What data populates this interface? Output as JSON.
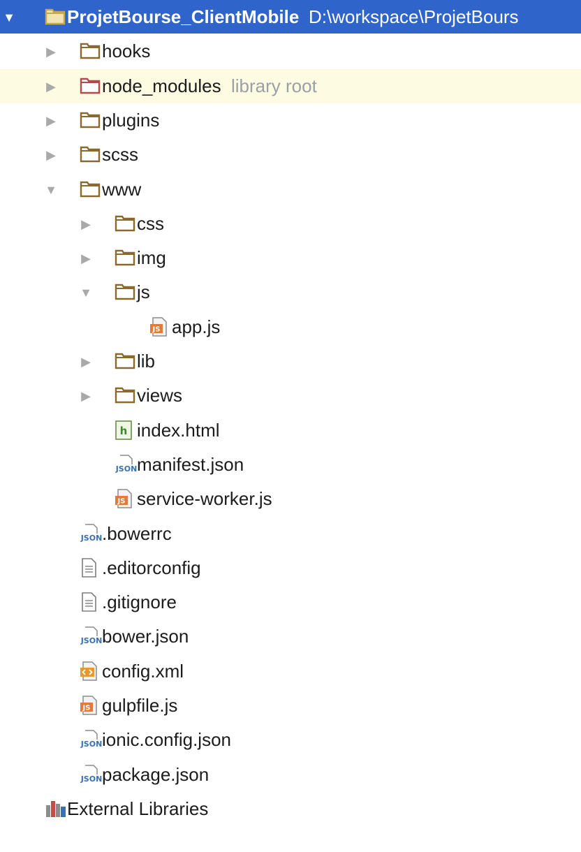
{
  "colors": {
    "selection": "#2f65ca",
    "highlight_row": "#fdfbe1",
    "folder": "#8a6a2c",
    "library_folder": "#b24a4a",
    "arrow": "#a9a9a9",
    "hint_text": "#9aa0a6"
  },
  "tree": [
    {
      "depth": 0,
      "arrow": "expanded",
      "icon": "folder-icon",
      "label": "ProjetBourse_ClientMobile",
      "hint": "D:\\workspace\\ProjetBours",
      "state": "selected"
    },
    {
      "depth": 1,
      "arrow": "collapsed",
      "icon": "folder-icon",
      "label": "hooks"
    },
    {
      "depth": 1,
      "arrow": "collapsed",
      "icon": "library-folder-icon",
      "label": "node_modules",
      "hint": "library root",
      "state": "highlight"
    },
    {
      "depth": 1,
      "arrow": "collapsed",
      "icon": "folder-icon",
      "label": "plugins"
    },
    {
      "depth": 1,
      "arrow": "collapsed",
      "icon": "folder-icon",
      "label": "scss"
    },
    {
      "depth": 1,
      "arrow": "expanded",
      "icon": "folder-icon",
      "label": "www"
    },
    {
      "depth": 2,
      "arrow": "collapsed",
      "icon": "folder-icon",
      "label": "css"
    },
    {
      "depth": 2,
      "arrow": "collapsed",
      "icon": "folder-icon",
      "label": "img"
    },
    {
      "depth": 2,
      "arrow": "expanded",
      "icon": "folder-icon",
      "label": "js"
    },
    {
      "depth": 3,
      "arrow": "none",
      "icon": "js-file-icon",
      "label": "app.js"
    },
    {
      "depth": 2,
      "arrow": "collapsed",
      "icon": "folder-icon",
      "label": "lib"
    },
    {
      "depth": 2,
      "arrow": "collapsed",
      "icon": "folder-icon",
      "label": "views"
    },
    {
      "depth": 2,
      "arrow": "none",
      "icon": "html-file-icon",
      "label": "index.html"
    },
    {
      "depth": 2,
      "arrow": "none",
      "icon": "json-file-icon",
      "label": "manifest.json"
    },
    {
      "depth": 2,
      "arrow": "none",
      "icon": "js-file-icon",
      "label": "service-worker.js"
    },
    {
      "depth": 1,
      "arrow": "none",
      "icon": "json-file-icon",
      "label": ".bowerrc"
    },
    {
      "depth": 1,
      "arrow": "none",
      "icon": "text-file-icon",
      "label": ".editorconfig"
    },
    {
      "depth": 1,
      "arrow": "none",
      "icon": "text-file-icon",
      "label": ".gitignore"
    },
    {
      "depth": 1,
      "arrow": "none",
      "icon": "json-file-icon",
      "label": "bower.json"
    },
    {
      "depth": 1,
      "arrow": "none",
      "icon": "xml-file-icon",
      "label": "config.xml"
    },
    {
      "depth": 1,
      "arrow": "none",
      "icon": "js-file-icon",
      "label": "gulpfile.js"
    },
    {
      "depth": 1,
      "arrow": "none",
      "icon": "json-file-icon",
      "label": "ionic.config.json"
    },
    {
      "depth": 1,
      "arrow": "none",
      "icon": "json-file-icon",
      "label": "package.json"
    },
    {
      "depth": 0,
      "arrow": "none",
      "icon": "external-libraries-icon",
      "label": "External Libraries"
    }
  ]
}
